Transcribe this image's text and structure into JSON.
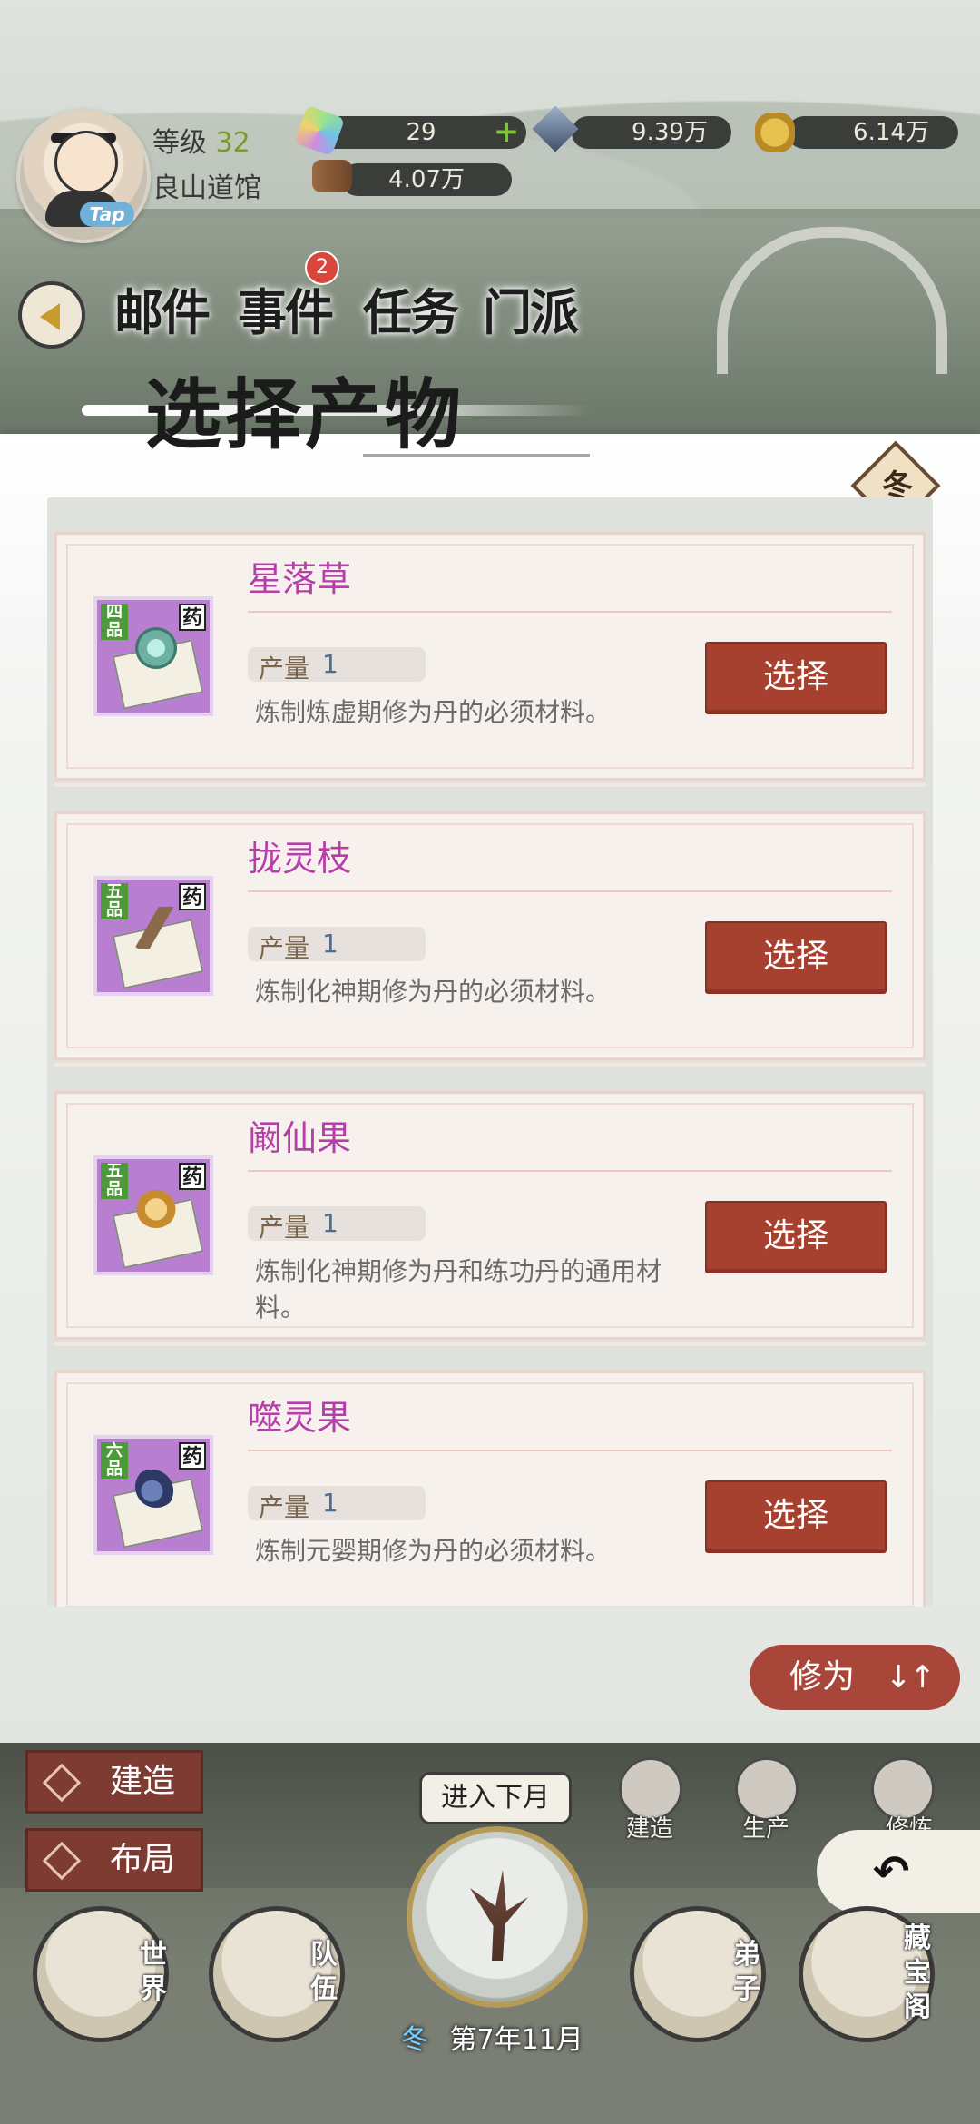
{
  "header": {
    "level_label": "等级",
    "level_value": "32",
    "guild_name": "良山道馆",
    "tap_label": "Tap",
    "resources": {
      "gems": "29",
      "crystals": "9.39万",
      "gold": "6.14万",
      "wood": "4.07万"
    }
  },
  "menu": {
    "tabs": [
      "邮件",
      "事件",
      "任务",
      "门派"
    ],
    "events_badge": "2"
  },
  "panel": {
    "title": "选择产物",
    "season_badge": "冬",
    "qty_label": "产量",
    "select_label": "选择",
    "items": [
      {
        "name": "星落草",
        "grade": "四品",
        "type": "药",
        "qty": "1",
        "desc": "炼制炼虚期修为丹的必须材料。",
        "herb_color": "#8fd3c8"
      },
      {
        "name": "拢灵枝",
        "grade": "五品",
        "type": "药",
        "qty": "1",
        "desc": "炼制化神期修为丹的必须材料。",
        "herb_color": "#8a6a4a"
      },
      {
        "name": "阚仙果",
        "grade": "五品",
        "type": "药",
        "qty": "1",
        "desc": "炼制化神期修为丹和练功丹的通用材料。",
        "herb_color": "#d8a247"
      },
      {
        "name": "噬灵果",
        "grade": "六品",
        "type": "药",
        "qty": "1",
        "desc": "炼制元婴期修为丹的必须材料。",
        "herb_color": "#3b4f8a"
      }
    ],
    "sort_label": "修为",
    "sort_icon": "↓↑"
  },
  "bottom": {
    "build_label": "建造",
    "layout_label": "布局",
    "next_month_label": "进入下月",
    "season": "冬",
    "date": "第7年11月",
    "round_buttons": [
      "建造",
      "生产",
      "修炼"
    ],
    "nav": {
      "world": "世界",
      "team": "队伍",
      "disciple": "弟子",
      "treasure": "藏宝阁"
    },
    "back_arrow": "↶"
  }
}
